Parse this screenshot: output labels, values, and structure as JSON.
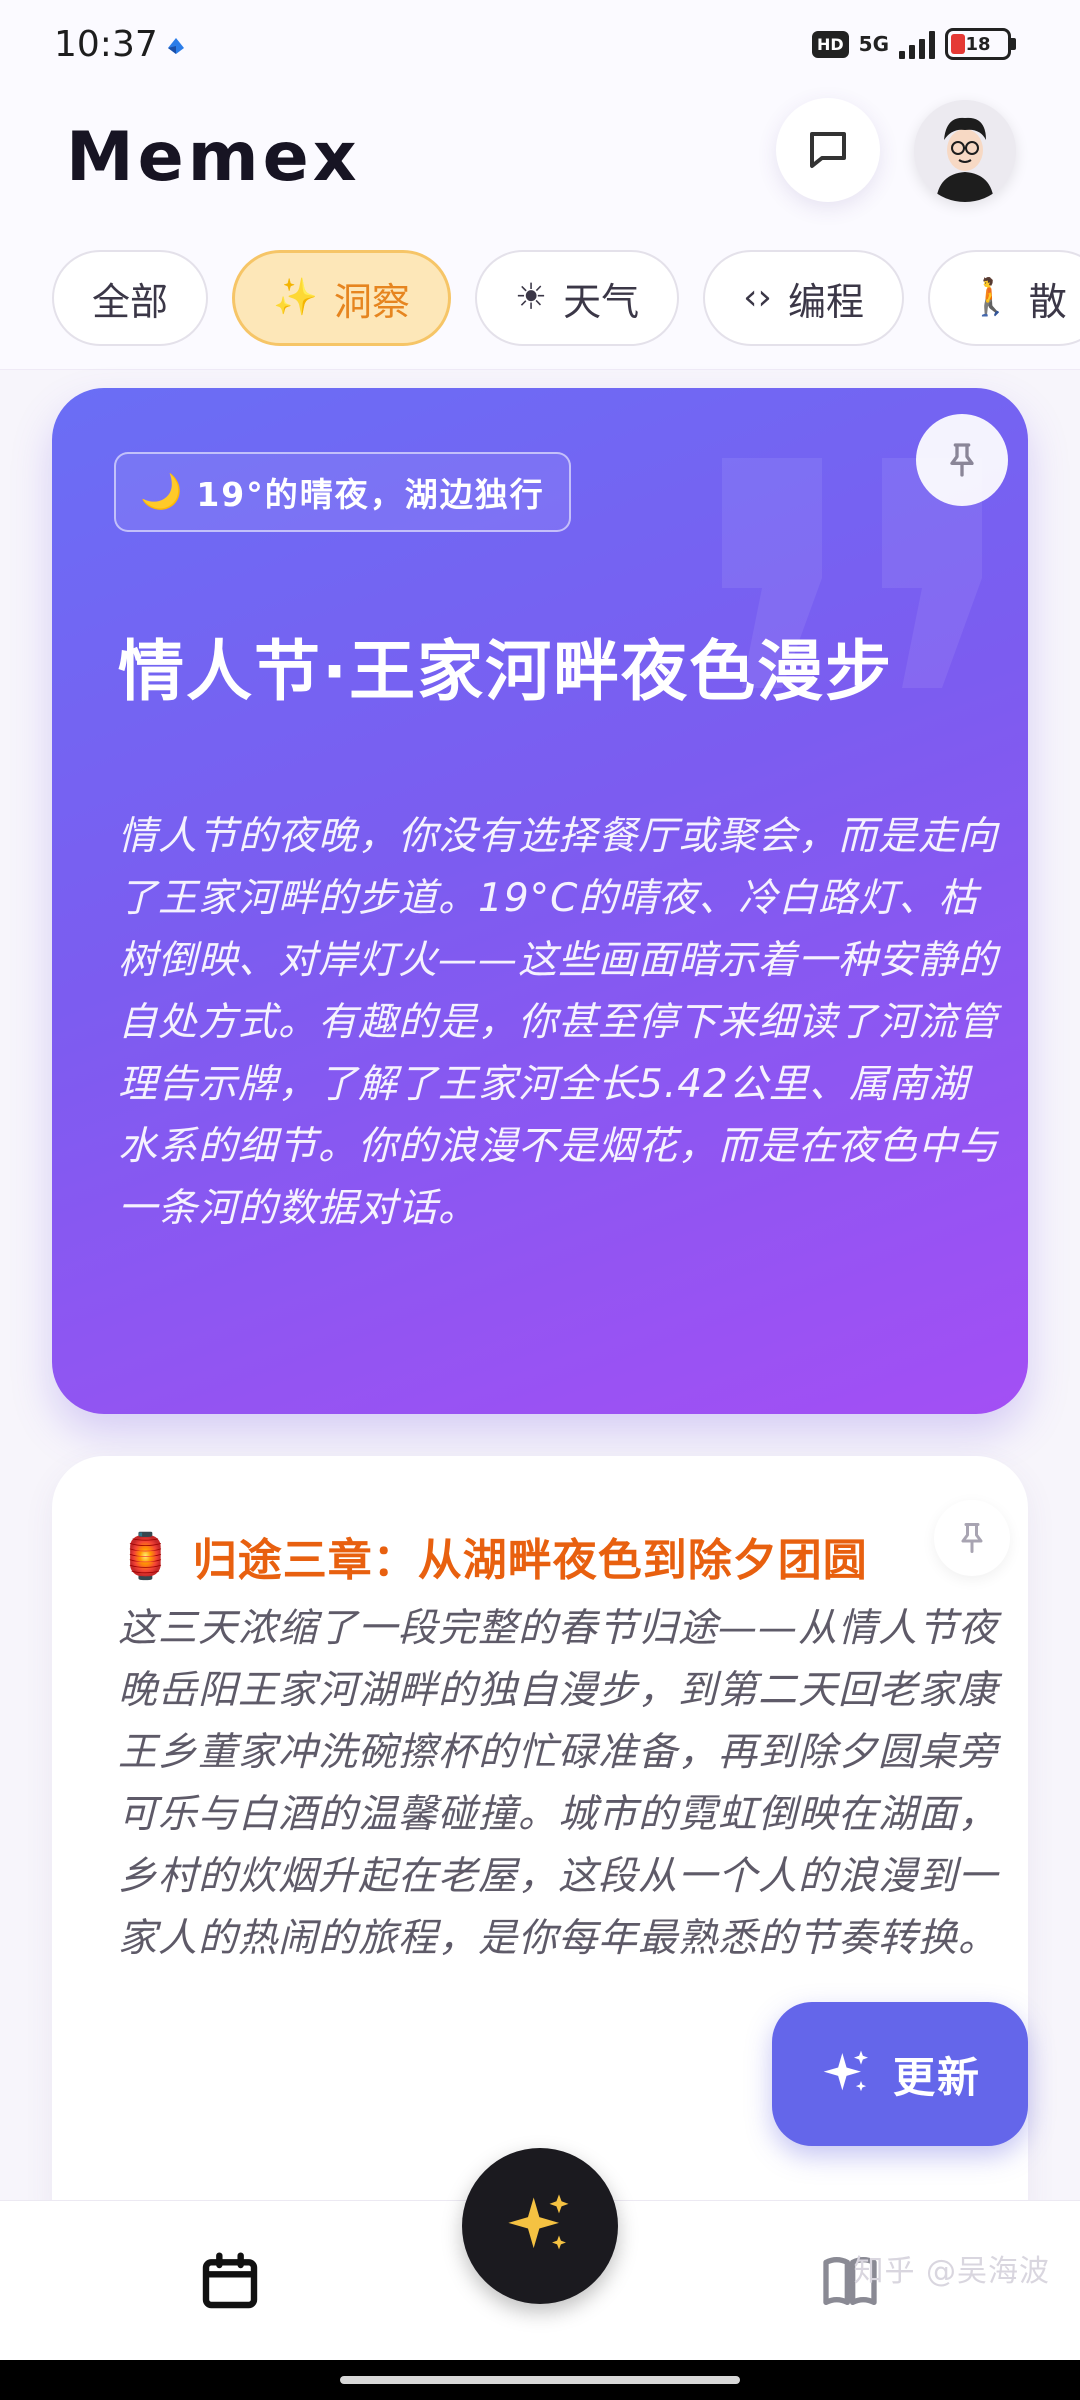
{
  "status_bar": {
    "time": "10:37",
    "hd": "HD",
    "network": "5G",
    "battery": "18"
  },
  "header": {
    "title": "Memex"
  },
  "chips": [
    {
      "label": "全部",
      "icon": "",
      "active": false
    },
    {
      "label": "洞察",
      "icon": "✨",
      "active": true
    },
    {
      "label": "天气",
      "icon": "☀",
      "active": false
    },
    {
      "label": "编程",
      "icon": "‹›",
      "active": false
    },
    {
      "label": "散",
      "icon": "🚶",
      "active": false
    }
  ],
  "insight_card": {
    "tag": "19°的晴夜，湖边独行",
    "tag_icon": "🌙",
    "title": "情人节·王家河畔夜色漫步",
    "body": "情人节的夜晚，你没有选择餐厅或聚会，而是走向了王家河畔的步道。19°C的晴夜、冷白路灯、枯树倒映、对岸灯火——这些画面暗示着一种安静的自处方式。有趣的是，你甚至停下来细读了河流管理告示牌，了解了王家河全长5.42公里、属南湖水系的细节。你的浪漫不是烟花，而是在夜色中与一条河的数据对话。",
    "gradient_start": "#6a6ef5",
    "gradient_end": "#a34ff4"
  },
  "story_card": {
    "icon": "🏮",
    "title": "归途三章：从湖畔夜色到除夕团圆",
    "body": "这三天浓缩了一段完整的春节归途——从情人节夜晚岳阳王家河湖畔的独自漫步，到第二天回老家康王乡董家冲洗碗擦杯的忙碌准备，再到除夕圆桌旁可乐与白酒的温馨碰撞。城市的霓虹倒映在湖面，乡村的炊烟升起在老屋，这段从一个人的浪漫到一家人的热闹的旅程，是你每年最熟悉的节奏转换。",
    "title_color": "#e8600f"
  },
  "refresh_button": {
    "label": "更新"
  },
  "watermark": "知乎 @吴海波",
  "colors": {
    "accent": "#6466ea",
    "chip_active_bg": "#fde7b8",
    "chip_active_text": "#e6851f"
  }
}
